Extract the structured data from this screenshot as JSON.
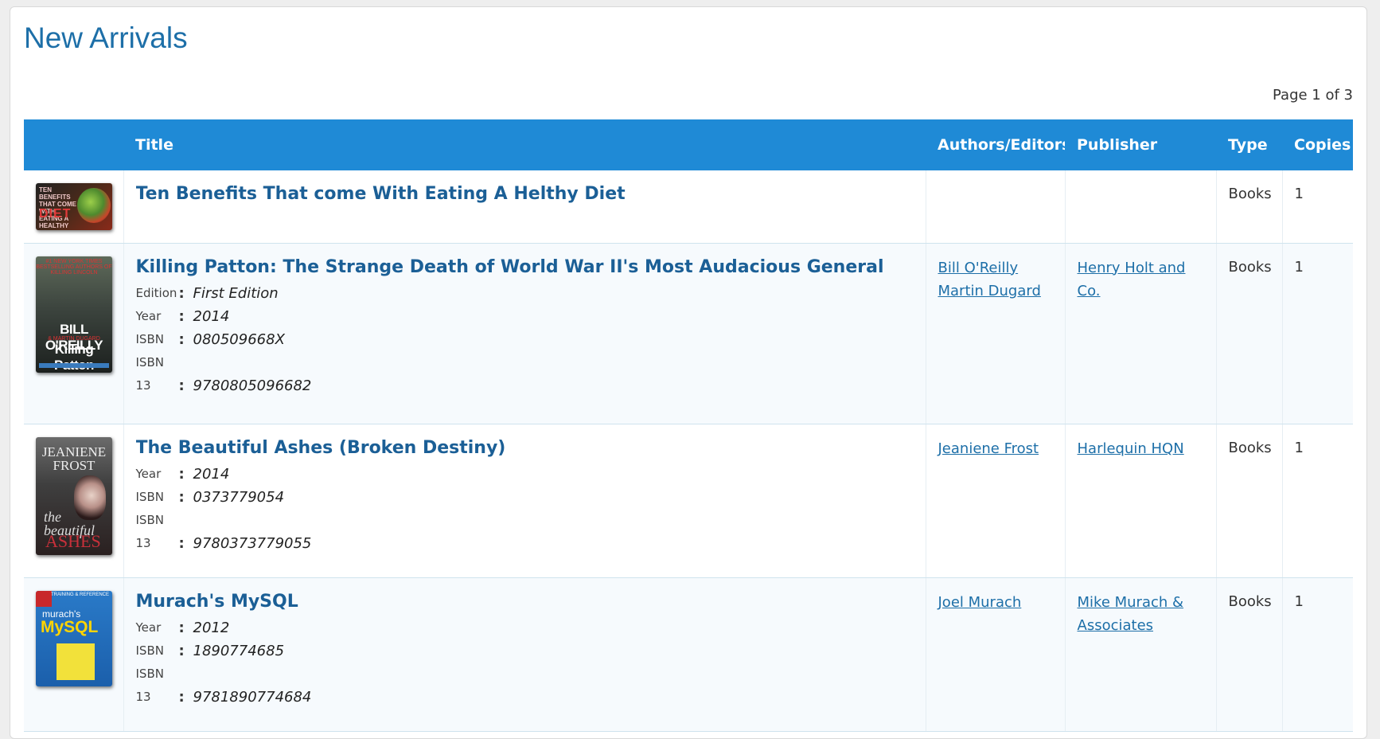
{
  "page": {
    "title": "New Arrivals",
    "pagination": "Page 1 of 3"
  },
  "columns": {
    "cover": "",
    "title": "Title",
    "authors": "Authors/Editors",
    "publisher": "Publisher",
    "type": "Type",
    "copies": "Copies"
  },
  "cover_text": {
    "c1_top": "TEN BENEFITS THAT COME WITH EATING A HEALTHY",
    "c1_big": "DIET",
    "c2_top": "#1 NEW YORK TIMES BESTSELLING AUTHORS OF KILLING LINCOLN",
    "c2_a": "BILL O'REILLY",
    "c2_b": "& MARTIN DUGARD",
    "c2_c": "Killing Patton",
    "c3_a": "JEANIENE FROST",
    "c3_b": "the beautiful",
    "c3_c": "ASHES",
    "c4_top": "TRAINING & REFERENCE",
    "c4_a": "murach's",
    "c4_b": "MySQL"
  },
  "books": [
    {
      "title": "Ten Benefits That come With Eating A Helthy Diet",
      "authors": [],
      "publisher": [],
      "type": "Books",
      "copies": "1"
    },
    {
      "title": "Killing Patton: The Strange Death of World War II's Most Audacious General",
      "edition_label": "Edition",
      "edition": "First Edition",
      "year_label": "Year",
      "year": "2014",
      "isbn_label": "ISBN",
      "isbn": "080509668X",
      "isbn13_label_a": "ISBN",
      "isbn13_label_b": "13",
      "isbn13": "9780805096682",
      "authors": [
        "Bill O'Reilly",
        "Martin Dugard"
      ],
      "publisher": [
        "Henry Holt and Co."
      ],
      "type": "Books",
      "copies": "1"
    },
    {
      "title": "The Beautiful Ashes (Broken Destiny)",
      "year_label": "Year",
      "year": "2014",
      "isbn_label": "ISBN",
      "isbn": "0373779054",
      "isbn13_label_a": "ISBN",
      "isbn13_label_b": "13",
      "isbn13": "9780373779055",
      "authors": [
        "Jeaniene Frost"
      ],
      "publisher": [
        "Harlequin HQN"
      ],
      "type": "Books",
      "copies": "1"
    },
    {
      "title": "Murach's MySQL",
      "year_label": "Year",
      "year": "2012",
      "isbn_label": "ISBN",
      "isbn": "1890774685",
      "isbn13_label_a": "ISBN",
      "isbn13_label_b": "13",
      "isbn13": "9781890774684",
      "authors": [
        "Joel Murach"
      ],
      "publisher": [
        "Mike Murach &",
        "Associates"
      ],
      "type": "Books",
      "copies": "1"
    }
  ]
}
